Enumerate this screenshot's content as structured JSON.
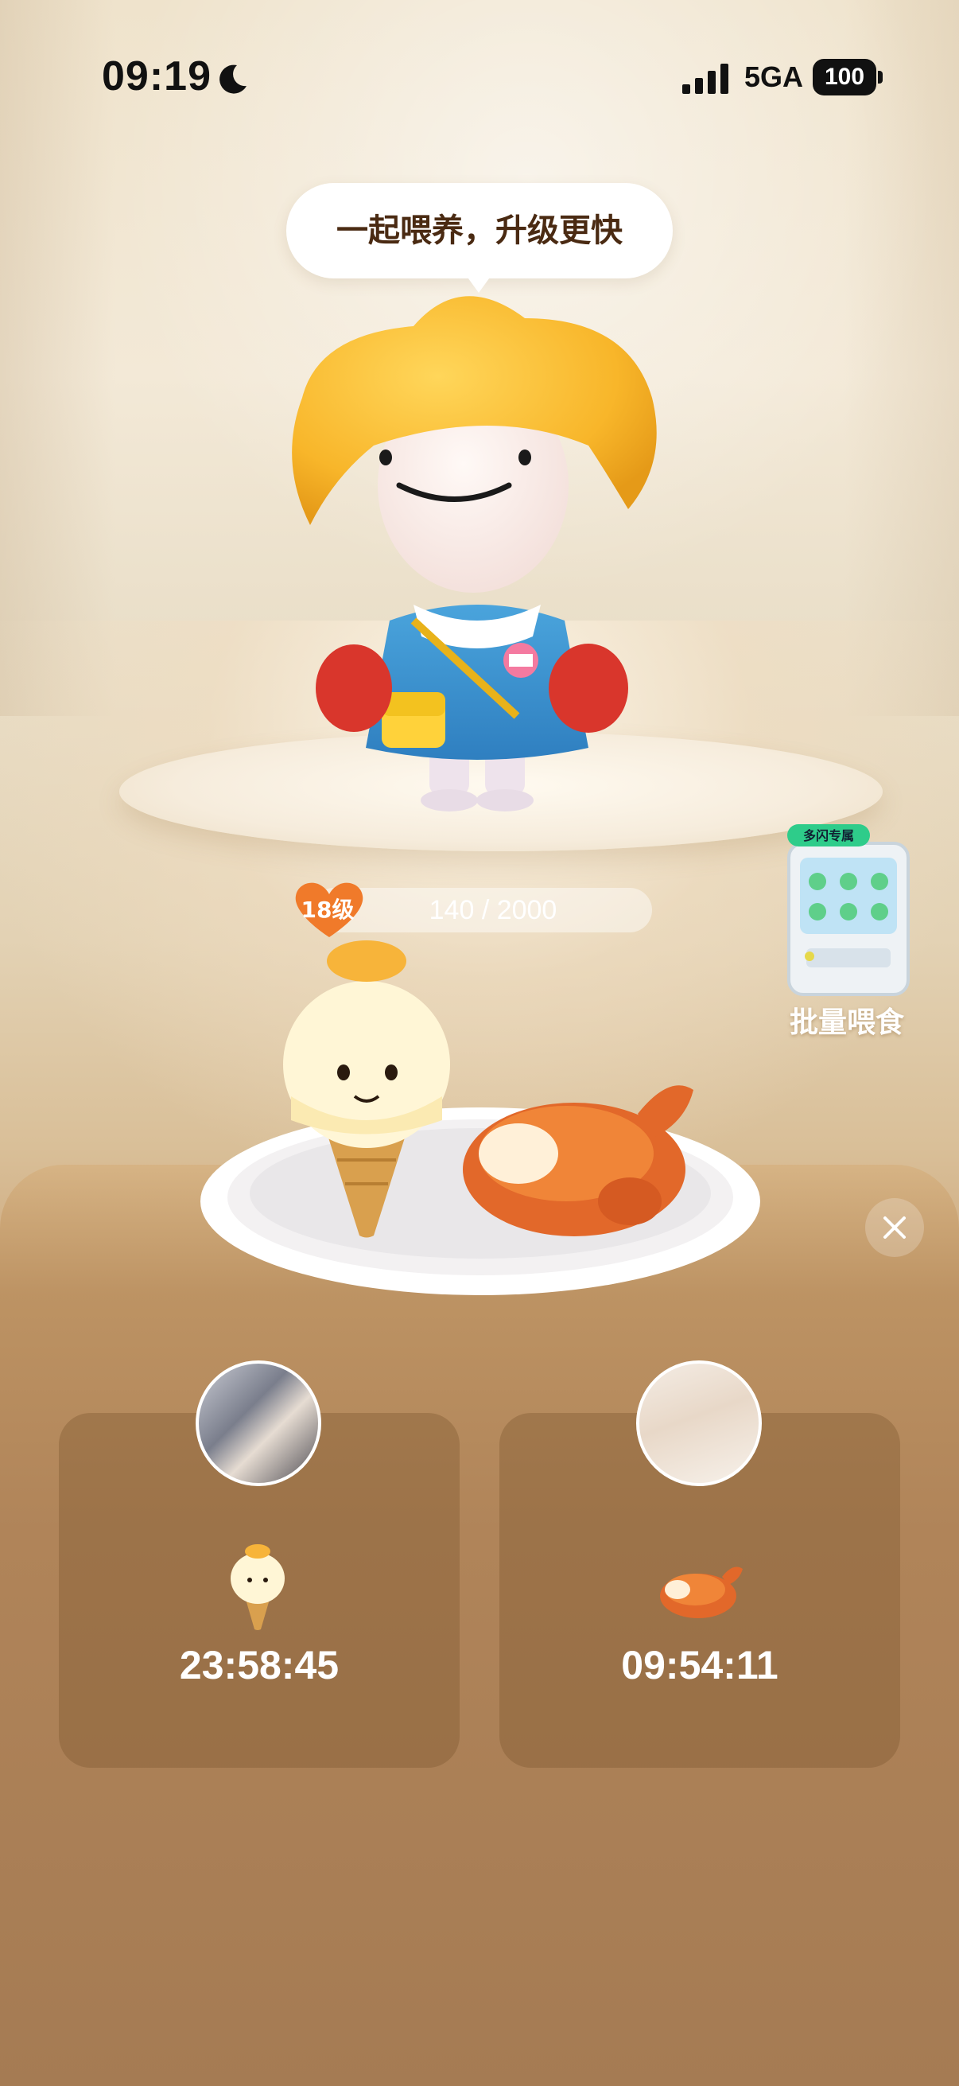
{
  "status_bar": {
    "time": "09:19",
    "network": "5GA",
    "battery": "100"
  },
  "speech_bubble": {
    "text": "一起喂养，升级更快"
  },
  "level": {
    "label": "18级",
    "progress_text": "140 / 2000",
    "current": 140,
    "max": 2000
  },
  "batch_feed": {
    "label": "批量喂食",
    "badge": "多闪专属"
  },
  "feed_cards": [
    {
      "food": "ice-cream",
      "timer": "23:58:45"
    },
    {
      "food": "roast-chicken",
      "timer": "09:54:11"
    }
  ],
  "colors": {
    "level_badge": "#f07a2a",
    "panel": "#a57b53",
    "bubble_text": "#4a2a12"
  }
}
